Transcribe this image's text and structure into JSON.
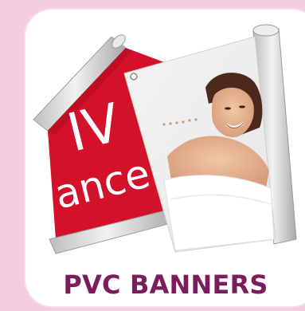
{
  "product": {
    "title": "PVC BANNERS",
    "red_banner_text": "ance",
    "red_banner_partial_letters": "IV"
  },
  "colors": {
    "background": "#f5cde1",
    "card": "#ffffff",
    "title": "#7b1d5c",
    "red_banner": "#d3112a",
    "roll": "#d9d9d9"
  }
}
